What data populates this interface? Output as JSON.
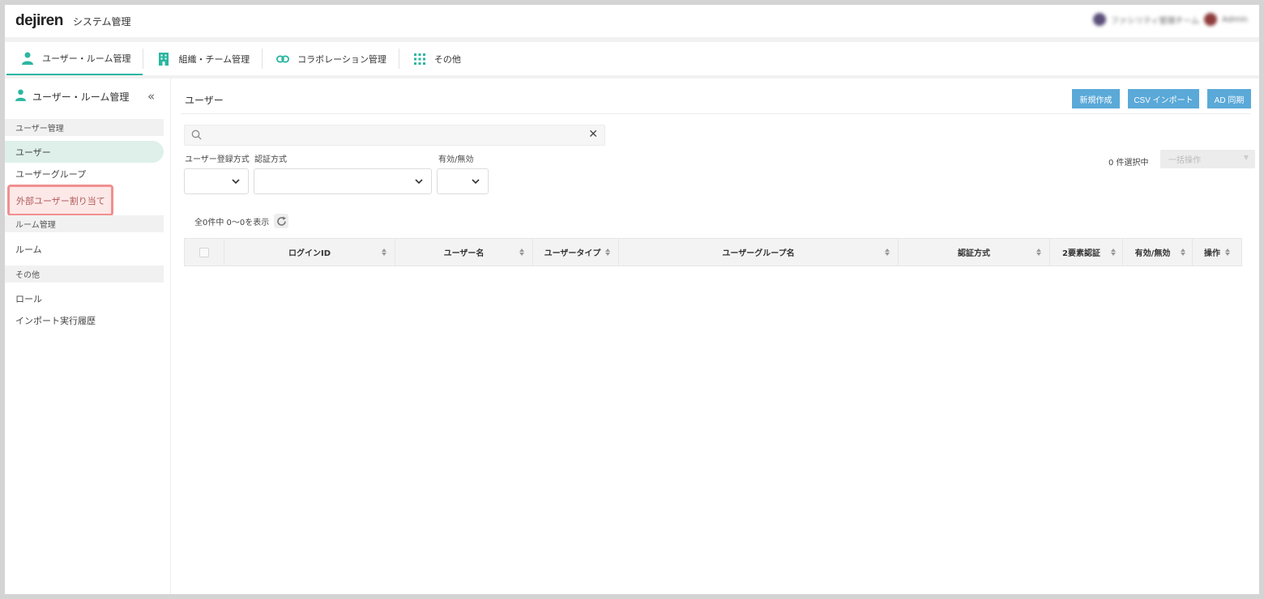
{
  "header": {
    "logo": "dejiren",
    "title": "システム管理",
    "user_text": "ファシリティ管理チーム",
    "user_name": "Admin"
  },
  "tabs": [
    {
      "label": "ユーザー・ルーム管理",
      "icon": "person-icon",
      "active": true
    },
    {
      "label": "組織・チーム管理",
      "icon": "building-icon"
    },
    {
      "label": "コラボレーション管理",
      "icon": "link-icon"
    },
    {
      "label": "その他",
      "icon": "grid-icon"
    }
  ],
  "sidebar": {
    "title": "ユーザー・ルーム管理",
    "sections": {
      "user": "ユーザー管理",
      "room": "ルーム管理",
      "other": "その他"
    },
    "items": {
      "user": "ユーザー",
      "user_group": "ユーザーグループ",
      "external": "外部ユーザー割り当て",
      "room": "ルーム",
      "role": "ロール",
      "import_history": "インポート実行履歴"
    }
  },
  "main": {
    "title": "ユーザー",
    "buttons": {
      "new": "新規作成",
      "csv": "CSV インポート",
      "ad": "AD 同期"
    },
    "search_value": "",
    "filters": {
      "reg": "ユーザー登録方式",
      "auth": "認証方式",
      "enabled": "有効/無効"
    },
    "selected_count": "0 件選択中",
    "bulk_action": "一括操作",
    "count_text": "全0件中 0〜0を表示"
  },
  "table": {
    "columns": [
      "ログインID",
      "ユーザー名",
      "ユーザータイプ",
      "ユーザーグループ名",
      "認証方式",
      "2要素認証",
      "有効/無効",
      "操作"
    ]
  },
  "colors": {
    "accent": "#2bb6a0",
    "button": "#5aa9d8",
    "highlight_border": "#f08f8f"
  }
}
